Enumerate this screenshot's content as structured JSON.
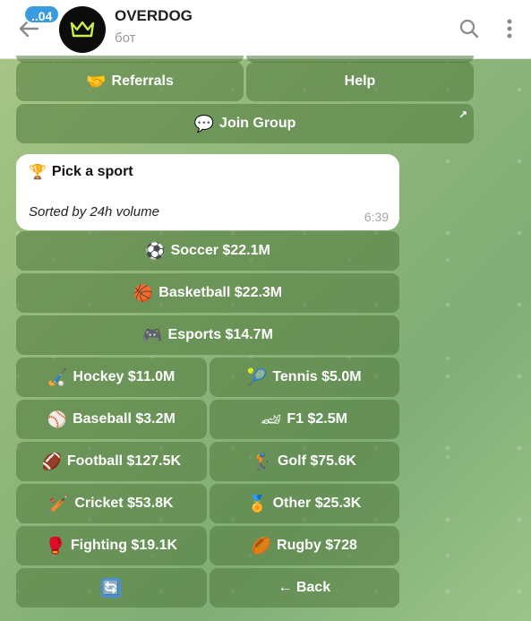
{
  "header": {
    "unread_count": "..04",
    "title": "OVERDOG",
    "subtitle": "бот"
  },
  "top_keyboard": {
    "referrals": {
      "emoji": "🤝",
      "label": "Referrals"
    },
    "help": {
      "label": "Help"
    },
    "join_group": {
      "emoji": "💬",
      "label": "Join Group",
      "link_icon": "↗"
    }
  },
  "message": {
    "emoji": "🏆",
    "title": "Pick a sport",
    "subtitle": "Sorted by 24h volume",
    "time": "6:39"
  },
  "keyboard": {
    "soccer": {
      "emoji": "⚽",
      "label": "Soccer $22.1M"
    },
    "basketball": {
      "emoji": "🏀",
      "label": "Basketball $22.3M"
    },
    "esports": {
      "emoji": "🎮",
      "label": "Esports $14.7M"
    },
    "hockey": {
      "emoji": "🏑",
      "label": "Hockey $11.0M"
    },
    "tennis": {
      "emoji": "🎾",
      "label": "Tennis $5.0M"
    },
    "baseball": {
      "emoji": "⚾",
      "label": "Baseball $3.2M"
    },
    "f1": {
      "emoji": "🏎",
      "label": "F1 $2.5M"
    },
    "football": {
      "emoji": "🏈",
      "label": "Football $127.5K"
    },
    "golf": {
      "emoji": "🏌",
      "label": "Golf $75.6K"
    },
    "cricket": {
      "emoji": "🏏",
      "label": "Cricket $53.8K"
    },
    "other": {
      "emoji": "🏅",
      "label": "Other $25.3K"
    },
    "fighting": {
      "emoji": "🥊",
      "label": "Fighting $19.1K"
    },
    "rugby": {
      "emoji": "🏉",
      "label": "Rugby $728"
    },
    "refresh": {
      "icon": "🔄"
    },
    "back": {
      "label": "← Back"
    }
  }
}
